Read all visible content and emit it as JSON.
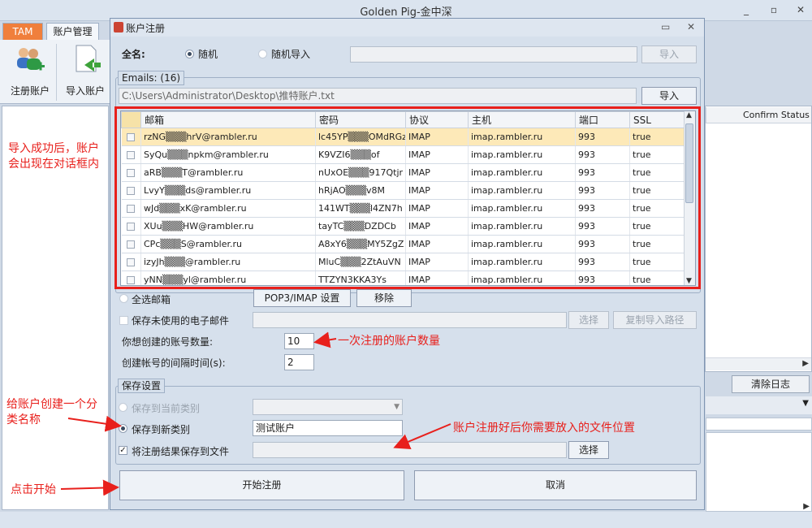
{
  "app": {
    "title": "Golden  Pig-金中深",
    "controls": [
      "_",
      "▫",
      "✕"
    ]
  },
  "tabs": [
    "TAM",
    "账户管理"
  ],
  "ribbon": {
    "register": "注册账户",
    "import": "导入账户"
  },
  "right_panel": {
    "confirm_status": "Confirm Status",
    "clear_log": "清除日志"
  },
  "dialog": {
    "title": "账户注册",
    "controls": [
      "▭",
      "✕"
    ],
    "fullname_label": "全名:",
    "radio_random": "随机",
    "radio_import": "随机导入",
    "import_btn_top": "导入",
    "emails_legend": "Emails: (16)",
    "file_path": "C:\\Users\\Administrator\\Desktop\\推特账户.txt",
    "import_btn": "导入",
    "grid": {
      "columns": [
        "邮箱",
        "密码",
        "协议",
        "主机",
        "端口",
        "SSL"
      ],
      "rows": [
        [
          "rzNG▒▒▒hrV@rambler.ru",
          "lc45YP▒▒▒OMdRGzl",
          "IMAP",
          "imap.rambler.ru",
          "993",
          "true"
        ],
        [
          "SyQu▒▒▒npkm@rambler.ru",
          "K9VZI6▒▒▒of",
          "IMAP",
          "imap.rambler.ru",
          "993",
          "true"
        ],
        [
          "aRB▒▒▒T@rambler.ru",
          "nUxOE▒▒▒917Qtjr",
          "IMAP",
          "imap.rambler.ru",
          "993",
          "true"
        ],
        [
          "LvyY▒▒▒ds@rambler.ru",
          "hRjAO▒▒▒v8M",
          "IMAP",
          "imap.rambler.ru",
          "993",
          "true"
        ],
        [
          "wJd▒▒▒xK@rambler.ru",
          "141WT▒▒▒l4ZN7h",
          "IMAP",
          "imap.rambler.ru",
          "993",
          "true"
        ],
        [
          "XUu▒▒▒HW@rambler.ru",
          "tayTC▒▒▒DZDCb",
          "IMAP",
          "imap.rambler.ru",
          "993",
          "true"
        ],
        [
          "CPc▒▒▒S@rambler.ru",
          "A8xY6▒▒▒MY5ZgZ",
          "IMAP",
          "imap.rambler.ru",
          "993",
          "true"
        ],
        [
          "izyJh▒▒▒@rambler.ru",
          "MluC▒▒▒2ZtAuVN",
          "IMAP",
          "imap.rambler.ru",
          "993",
          "true"
        ],
        [
          "yNN▒▒▒yl@rambler.ru",
          "TTZYN3KKA3Ys",
          "IMAP",
          "imap.rambler.ru",
          "993",
          "true"
        ]
      ]
    },
    "select_all": "全选邮箱",
    "pop3_btn": "POP3/IMAP 设置",
    "remove_btn": "移除",
    "save_unused": "保存未使用的电子邮件",
    "choose_btn": "选择",
    "copy_path_btn": "复制导入路径",
    "count_label": "你想创建的账号数量:",
    "count_value": "10",
    "interval_label": "创建帐号的间隔时间(s):",
    "interval_value": "2",
    "save_legend": "保存设置",
    "save_current": "保存到当前类别",
    "save_new": "保存到新类别",
    "new_category_value": "测试账户",
    "save_to_file": "将注册结果保存到文件",
    "choose_btn2": "选择",
    "start_btn": "开始注册",
    "cancel_btn": "取消"
  },
  "annotations": {
    "imported": "导入成功后，账户会出现在对话框内",
    "count": "一次注册的账户数量",
    "category": "给账户创建一个分类名称",
    "file": "账户注册好后你需要放入的文件位置",
    "start": "点击开始"
  },
  "colors": {
    "annotation_red": "#e8201c",
    "tam_orange": "#f07f3c",
    "selected_row": "#fde9b8"
  }
}
